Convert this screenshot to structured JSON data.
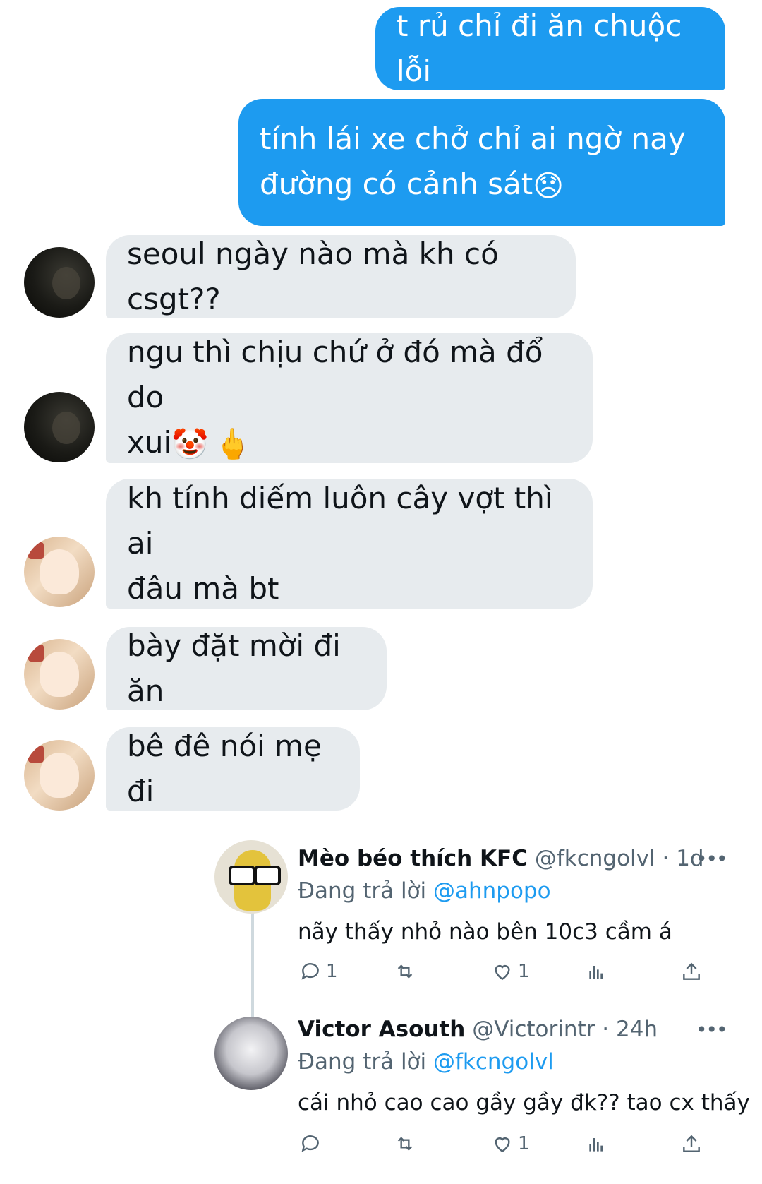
{
  "messages": [
    {
      "side": "out",
      "text": "t rủ chỉ đi ăn chuộc lỗi"
    },
    {
      "side": "out",
      "text": "tính lái xe chở chỉ ai ngờ nay",
      "text2": "đường có cảnh sát",
      "emoji": "😞"
    },
    {
      "side": "in",
      "avatar": "dark-portrait-avatar",
      "text": "seoul ngày nào mà kh có csgt??"
    },
    {
      "side": "in",
      "avatar": "dark-portrait-avatar",
      "text": "ngu thì chịu chứ ở đó mà đổ do",
      "text2": "xui",
      "emoji": "🤡",
      "emoji2": "🖕"
    },
    {
      "side": "in",
      "avatar": "girl-portrait-avatar",
      "text": "kh tính diếm luôn cây vợt thì ai",
      "text2": "đâu mà bt"
    },
    {
      "side": "in",
      "avatar": "girl-portrait-avatar",
      "text": "bày đặt mời đi ăn"
    },
    {
      "side": "in",
      "avatar": "girl-portrait-avatar",
      "text": "bê đê nói mẹ đi"
    }
  ],
  "tweets": [
    {
      "name": "Mèo béo thích KFC",
      "handle": "@fkcngolvl",
      "time": "· 1d",
      "replying_prefix": "Đang trả lời",
      "replying_to": "@ahnpopo",
      "text": "nãy thấy nhỏ nào bên 10c3 cầm á",
      "reply_count": "1",
      "like_count": "1"
    },
    {
      "name": "Victor Asouth",
      "handle": "@Victorintr",
      "time": "· 24h",
      "replying_prefix": "Đang trả lời",
      "replying_to": "@fkcngolvl",
      "text": "cái nhỏ cao cao gầy gầy đk?? tao cx thấy",
      "reply_count": "",
      "like_count": "1"
    }
  ],
  "more_glyph": "•••",
  "colors": {
    "outgoing": "#1d9bf0",
    "incoming": "#e7ebee",
    "muted": "#536471",
    "link": "#1d9bf0"
  }
}
